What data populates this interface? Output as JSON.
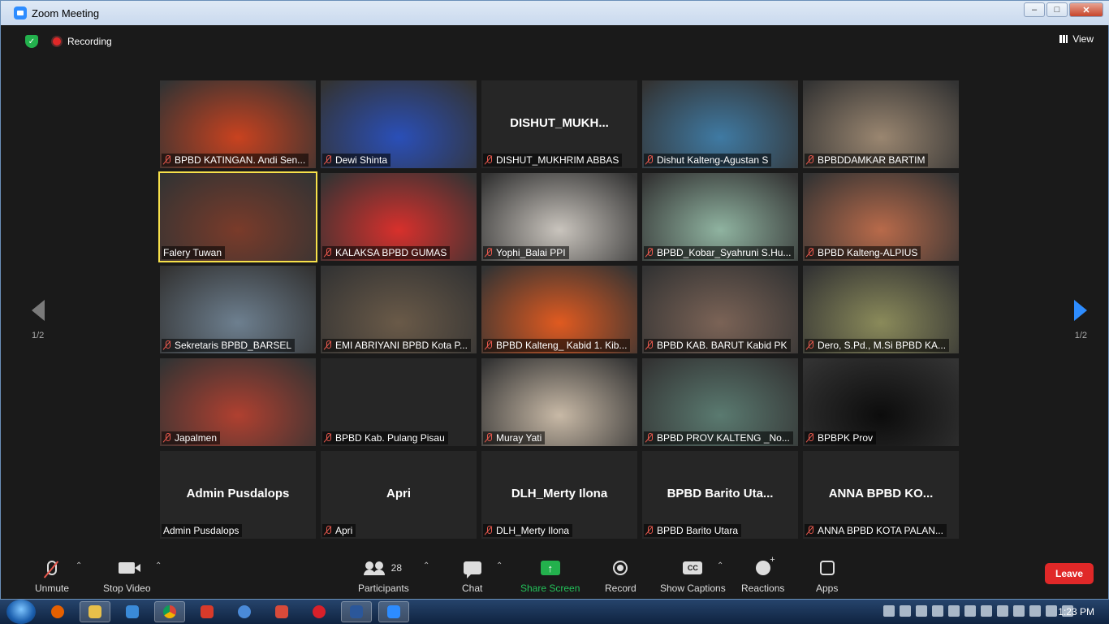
{
  "window": {
    "title": "Zoom Meeting",
    "controls": [
      "minimize",
      "maximize",
      "close"
    ]
  },
  "topbar": {
    "recording_label": "Recording",
    "view_label": "View"
  },
  "pagination": {
    "left": "1/2",
    "right": "1/2"
  },
  "participants": [
    {
      "label": "BPBD KATINGAN. Andi Sen...",
      "muted": true,
      "video": true,
      "color": "#c9421f"
    },
    {
      "label": "Dewi Shinta",
      "muted": true,
      "video": true,
      "color": "#2a4fb8"
    },
    {
      "label": "DISHUT_MUKHRIM ABBAS",
      "muted": true,
      "video": false,
      "avatar": "DISHUT_MUKH..."
    },
    {
      "label": "Dishut Kalteng-Agustan S",
      "muted": true,
      "video": true,
      "color": "#3f7aa3"
    },
    {
      "label": "BPBDDAMKAR BARTIM",
      "muted": true,
      "video": true,
      "color": "#9a8670"
    },
    {
      "label": "Falery Tuwan",
      "muted": false,
      "video": true,
      "active": true,
      "color": "#7a3b2a"
    },
    {
      "label": "KALAKSA BPBD GUMAS",
      "muted": true,
      "video": true,
      "color": "#d8302c"
    },
    {
      "label": "Yophi_Balai PPI",
      "muted": true,
      "video": true,
      "color": "#c9c4bd"
    },
    {
      "label": "BPBD_Kobar_Syahruni S.Hu...",
      "muted": true,
      "video": true,
      "color": "#8fb3a0"
    },
    {
      "label": "BPBD Kalteng-ALPIUS",
      "muted": true,
      "video": true,
      "color": "#b86a4a"
    },
    {
      "label": "Sekretaris BPBD_BARSEL",
      "muted": true,
      "video": true,
      "color": "#6d7f8f"
    },
    {
      "label": "EMI ABRIYANI BPBD Kota P...",
      "muted": true,
      "video": true,
      "color": "#6a5a48"
    },
    {
      "label": "BPBD Kalteng_ Kabid 1. Kib...",
      "muted": true,
      "video": true,
      "color": "#e05a20"
    },
    {
      "label": "BPBD KAB. BARUT Kabid PK",
      "muted": true,
      "video": true,
      "color": "#7b6356"
    },
    {
      "label": "Dero, S.Pd., M.Si  BPBD KA...",
      "muted": true,
      "video": true,
      "color": "#8a8a5a"
    },
    {
      "label": "Japalmen",
      "muted": true,
      "video": true,
      "color": "#b04030"
    },
    {
      "label": "BPBD Kab. Pulang Pisau",
      "muted": true,
      "video": false,
      "avatar": ""
    },
    {
      "label": "Muray Yati",
      "muted": true,
      "video": true,
      "color": "#c8b9a6"
    },
    {
      "label": "BPBD PROV KALTENG _No...",
      "muted": true,
      "video": true,
      "color": "#5a7a70"
    },
    {
      "label": "BPBPK Prov",
      "muted": true,
      "video": true,
      "color": "#0c0c0c"
    },
    {
      "label": "Admin Pusdalops",
      "muted": false,
      "video": false,
      "avatar": "Admin Pusdalops"
    },
    {
      "label": "Apri",
      "muted": true,
      "video": false,
      "avatar": "Apri"
    },
    {
      "label": "DLH_Merty Ilona",
      "muted": true,
      "video": false,
      "avatar": "DLH_Merty Ilona"
    },
    {
      "label": "BPBD Barito Utara",
      "muted": true,
      "video": false,
      "avatar": "BPBD Barito Uta..."
    },
    {
      "label": "ANNA BPBD KOTA PALAN...",
      "muted": true,
      "video": false,
      "avatar": "ANNA BPBD KO..."
    }
  ],
  "toolbar": {
    "unmute": "Unmute",
    "stop_video": "Stop Video",
    "participants": "Participants",
    "participants_count": "28",
    "chat": "Chat",
    "share_screen": "Share Screen",
    "record": "Record",
    "show_captions": "Show Captions",
    "reactions": "Reactions",
    "apps": "Apps",
    "leave": "Leave",
    "share_color": "#23b14d",
    "leave_color": "#e02828"
  },
  "taskbar": {
    "clock": "1:23 PM"
  }
}
